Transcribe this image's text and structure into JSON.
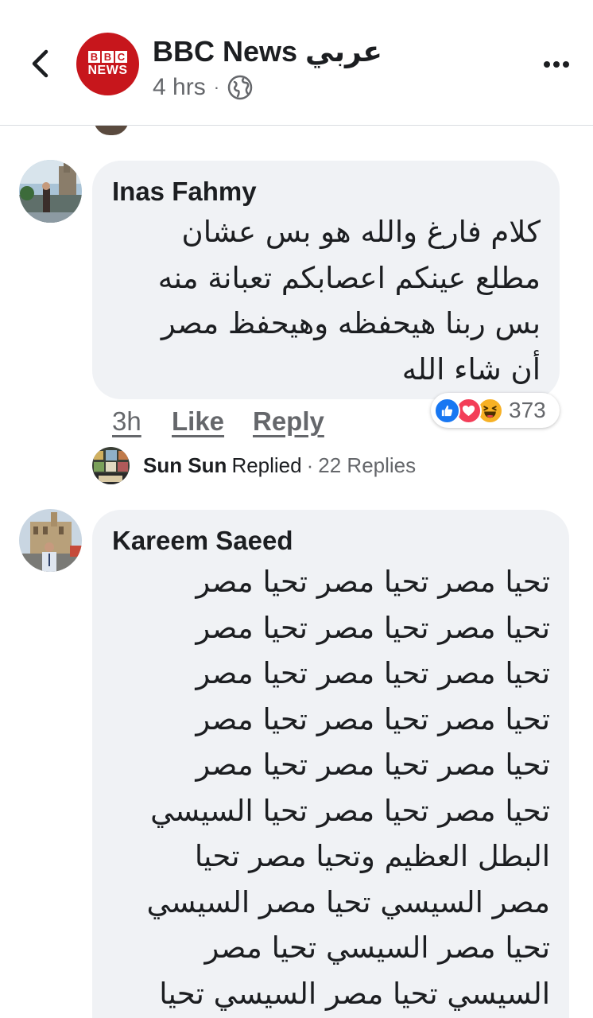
{
  "header": {
    "page_name": "BBC News عربي",
    "time": "4 hrs",
    "separator": "·",
    "logo_letters": [
      "B",
      "B",
      "C"
    ],
    "logo_word": "NEWS",
    "privacy_icon": "globe-icon",
    "back_icon": "chevron-left-icon",
    "more_icon": "more-dots-icon"
  },
  "comments": [
    {
      "author": "Inas Fahmy",
      "lines": [
        "كلام فارغ والله هو بس عشان",
        "مطلع عينكم اعصابكم تعبانة منه",
        "بس ربنا هيحفظه وهيحفظ مصر",
        "أن شاء الله"
      ],
      "time": "3h",
      "like_label": "Like",
      "reply_label": "Reply",
      "reactions": {
        "icons": [
          "like-icon",
          "love-icon",
          "haha-icon"
        ],
        "count": "373"
      },
      "reply_summary": {
        "name": "Sun Sun",
        "verb": "Replied",
        "separator": "·",
        "count_label": "22 Replies"
      }
    },
    {
      "author": "Kareem Saeed",
      "lines": [
        "تحيا مصر تحيا مصر تحيا مصر",
        "تحيا مصر تحيا مصر تحيا مصر",
        "تحيا مصر تحيا مصر تحيا مصر",
        "تحيا مصر تحيا مصر تحيا مصر",
        "تحيا مصر تحيا مصر تحيا مصر",
        "تحيا مصر تحيا مصر تحيا السيسي",
        "البطل العظيم وتحيا مصر تحيا",
        "مصر السيسي تحيا مصر السيسي",
        "تحيا مصر السيسي تحيا مصر",
        "السيسي تحيا مصر السيسي تحيا"
      ]
    }
  ],
  "colors": {
    "bbc_red": "#c7161c",
    "bubble_bg": "#f0f2f5",
    "meta_gray": "#65676b",
    "like_blue": "#1877f2",
    "love_red": "#f33e58",
    "haha_yellow": "#f7b125"
  }
}
